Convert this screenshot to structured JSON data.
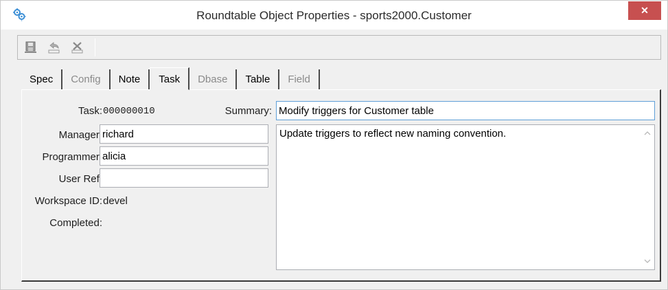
{
  "window": {
    "title": "Roundtable Object Properties - sports2000.Customer",
    "close_label": "✕"
  },
  "toolbar": {
    "buttons": [
      {
        "icon": "save-icon"
      },
      {
        "icon": "undo-icon"
      },
      {
        "icon": "delete-icon"
      }
    ]
  },
  "tabs": [
    {
      "label": "Spec",
      "state": "enabled"
    },
    {
      "label": "Config",
      "state": "disabled"
    },
    {
      "label": "Note",
      "state": "enabled"
    },
    {
      "label": "Task",
      "state": "active"
    },
    {
      "label": "Dbase",
      "state": "disabled"
    },
    {
      "label": "Table",
      "state": "enabled"
    },
    {
      "label": "Field",
      "state": "disabled"
    }
  ],
  "task": {
    "task_label": "Task:",
    "task_value": "000000010",
    "manager_label": "Manager:",
    "manager_value": "richard",
    "programmer_label": "Programmer:",
    "programmer_value": "alicia",
    "userref_label": "User Ref:",
    "userref_value": "",
    "workspace_label": "Workspace ID:",
    "workspace_value": "devel",
    "completed_label": "Completed:",
    "summary_label": "Summary:",
    "summary_value": "Modify triggers for Customer table",
    "description_value": "Update triggers to reflect new naming convention."
  },
  "colors": {
    "close_button": "#c75050",
    "focus_border": "#5f9fd7",
    "window_bg": "#f0f0f0"
  }
}
